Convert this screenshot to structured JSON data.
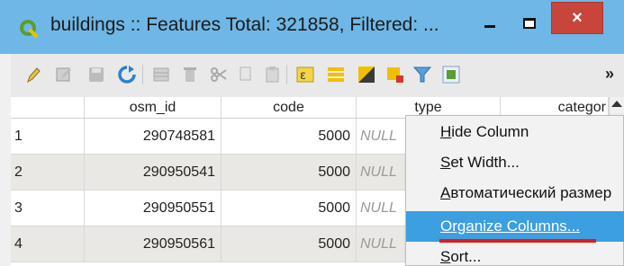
{
  "window": {
    "title": "buildings :: Features Total: 321858, Filtered: ...",
    "minimize_label": "",
    "maximize_label": "",
    "close_label": "×",
    "titlebar_color": "#6fb7e6",
    "close_color": "#c7453b"
  },
  "toolbar": {
    "more_label": "»",
    "icons": [
      "pencil-icon",
      "multiedit-icon",
      "save-icon",
      "reload-icon",
      "add-feature-icon",
      "delete-icon",
      "cut-icon",
      "copy-icon",
      "paste-icon",
      "select-expression-icon",
      "select-all-icon",
      "invert-selection-icon",
      "deselect-icon",
      "filter-icon",
      "zoom-to-selection-icon"
    ]
  },
  "table": {
    "columns": [
      "",
      "osm_id",
      "code",
      "type",
      "categor"
    ],
    "rows": [
      {
        "index": "1",
        "osm_id": "290748581",
        "code": "5000",
        "type": "NULL"
      },
      {
        "index": "2",
        "osm_id": "290950541",
        "code": "5000",
        "type": "NULL"
      },
      {
        "index": "3",
        "osm_id": "290950551",
        "code": "5000",
        "type": "NULL"
      },
      {
        "index": "4",
        "osm_id": "290950561",
        "code": "5000",
        "type": "NULL"
      }
    ]
  },
  "context_menu": {
    "items": [
      {
        "label": "Hide Column",
        "accel": "H",
        "rest": "ide Column"
      },
      {
        "label": "Set Width...",
        "accel": "S",
        "rest": "et Width..."
      },
      {
        "label": "Автоматический размер",
        "accel": "А",
        "rest": "втоматический размер"
      },
      {
        "label": "Organize Columns...",
        "accel": "",
        "rest": "Organize Columns..."
      },
      {
        "label": "Sort...",
        "accel": "S",
        "rest": "ort..."
      }
    ],
    "selected_index": 3,
    "highlight_color": "#3b9fe0",
    "annotation_color": "#e01b1b"
  }
}
